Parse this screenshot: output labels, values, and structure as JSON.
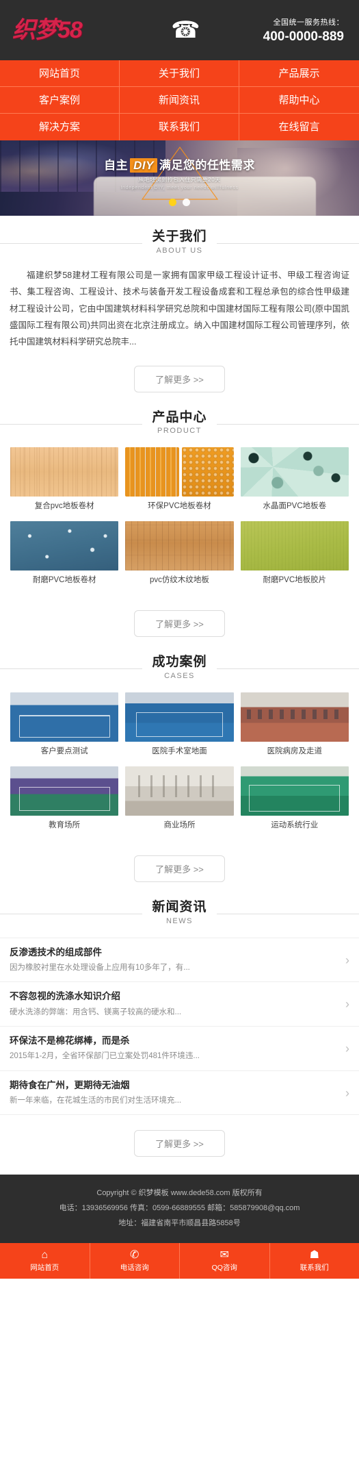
{
  "header": {
    "logo_text": "织梦58",
    "phone_icon": "telephone-icon",
    "hotline_label": "全国统一服务热线：",
    "hotline_number": "400-0000-889"
  },
  "nav": {
    "items": [
      {
        "label": "网站首页",
        "name": "nav-item-home"
      },
      {
        "label": "关于我们",
        "name": "nav-item-about"
      },
      {
        "label": "产品展示",
        "name": "nav-item-products"
      },
      {
        "label": "客户案例",
        "name": "nav-item-cases"
      },
      {
        "label": "新闻资讯",
        "name": "nav-item-news"
      },
      {
        "label": "帮助中心",
        "name": "nav-item-help"
      },
      {
        "label": "解决方案",
        "name": "nav-item-solutions"
      },
      {
        "label": "联系我们",
        "name": "nav-item-contact"
      },
      {
        "label": "在线留言",
        "name": "nav-item-message"
      }
    ]
  },
  "banner": {
    "title_pre": "自主",
    "title_badge": "DIY",
    "title_post": "满足您的任性需求",
    "subtitle_cn": "从毛坯房到拎包入住只需要20天",
    "subtitle_en": "Independent DIY, meet your needs willfulness",
    "dots": [
      {
        "active": true
      },
      {
        "active": false
      }
    ]
  },
  "about": {
    "title_cn": "关于我们",
    "title_en": "ABOUT US",
    "body": "福建织梦58建材工程有限公司是一家拥有国家甲级工程设计证书、甲级工程咨询证书、集工程咨询、工程设计、技术与装备开发工程设备成套和工程总承包的综合性甲级建材工程设计公司，它由中国建筑材料科学研究总院和中国建材国际工程有限公司(原中国凯盛国际工程有限公司)共同出资在北京注册成立。纳入中国建材国际工程公司管理序列，依托中国建筑材料科学研究总院丰...",
    "more_label": "了解更多 >>"
  },
  "product": {
    "title_cn": "产品中心",
    "title_en": "PRODUCT",
    "items": [
      {
        "caption": "复合pvc地板卷材",
        "tex": "tx-wood-light"
      },
      {
        "caption": "环保PVC地板卷材",
        "tex": "tx-tactile"
      },
      {
        "caption": "水晶面PVC地板卷",
        "tex": "tx-terrazzo"
      },
      {
        "caption": "耐磨PVC地板卷材",
        "tex": "tx-blue-speck"
      },
      {
        "caption": "pvc仿纹木纹地板",
        "tex": "tx-wood-plank"
      },
      {
        "caption": "耐磨PVC地板胶片",
        "tex": "tx-green"
      }
    ],
    "more_label": "了解更多 >>"
  },
  "cases": {
    "title_cn": "成功案例",
    "title_en": "CASES",
    "items": [
      {
        "caption": "客户要点测试",
        "tex": "tx-court-blue"
      },
      {
        "caption": "医院手术室地面",
        "tex": "tx-court-blue2"
      },
      {
        "caption": "医院病房及走道",
        "tex": "tx-room-red"
      },
      {
        "caption": "教育场所",
        "tex": "tx-court-purple"
      },
      {
        "caption": "商业场所",
        "tex": "tx-hall-grey"
      },
      {
        "caption": "运动系统行业",
        "tex": "tx-court-green"
      }
    ],
    "more_label": "了解更多 >>"
  },
  "news": {
    "title_cn": "新闻资讯",
    "title_en": "NEWS",
    "items": [
      {
        "title": "反渗透技术的组成部件",
        "desc": "因为橡胶衬里在水处理设备上应用有10多年了，有..."
      },
      {
        "title": "不容忽视的洗涤水知识介绍",
        "desc": "硬水洗涤的弊端：用含钙、镁离子较高的硬水和..."
      },
      {
        "title": "环保法不是棉花绑棒，而是杀",
        "desc": "2015年1-2月，全省环保部门已立案处罚481件环境违..."
      },
      {
        "title": "期待食在广州，更期待无油烟",
        "desc": "新一年来临，在花城生活的市民们对生活环境充..."
      }
    ],
    "more_label": "了解更多 >>"
  },
  "footer": {
    "copyright": "Copyright © 织梦模板 www.dede58.com 版权所有",
    "contact": "电话：13936569956 传真：0599-66889555 邮箱：585879908@qq.com",
    "address": "地址：福建省南平市顺昌县路5858号"
  },
  "bottombar": {
    "items": [
      {
        "icon": "home-icon",
        "glyph": "⌂",
        "label": "网站首页",
        "name": "bottom-item-home"
      },
      {
        "icon": "phone-icon",
        "glyph": "✆",
        "label": "电话咨询",
        "name": "bottom-item-call"
      },
      {
        "icon": "chat-icon",
        "glyph": "✉",
        "label": "QQ咨询",
        "name": "bottom-item-qq"
      },
      {
        "icon": "user-icon",
        "glyph": "☗",
        "label": "联系我们",
        "name": "bottom-item-contact"
      }
    ]
  },
  "colors": {
    "accent": "#f5431a",
    "header_bg": "#2e2e2e",
    "logo_red": "#d6234b",
    "diy_orange": "#f5901a",
    "dot_active": "#ffd21a"
  }
}
